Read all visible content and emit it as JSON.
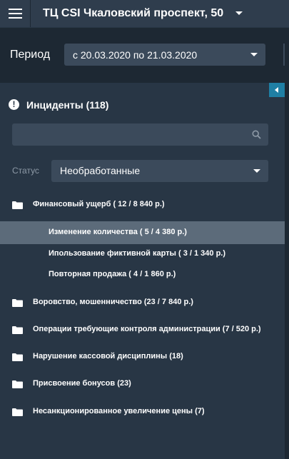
{
  "header": {
    "title": "ТЦ CSI Чкаловский проспект, 50"
  },
  "period": {
    "label": "Период",
    "value": "с 20.03.2020 по 21.03.2020"
  },
  "incidents": {
    "title": "Инциденты (118)",
    "search_placeholder": "",
    "status_label": "Статус",
    "status_value": "Необработанные"
  },
  "tree": {
    "groups": [
      {
        "label": "Финансовый ущерб ( 12 / 8 840 р.)"
      },
      {
        "label": "Воровство, мошенничество (23 / 7 840 р.)"
      },
      {
        "label": "Операции требующие контроля администрации (7 / 520 р.)"
      },
      {
        "label": "Нарушение кассовой дисциплины (18)"
      },
      {
        "label": "Присвоение бонусов (23)"
      },
      {
        "label": "Несанкционированное увеличение цены (7)"
      }
    ],
    "children": [
      {
        "label": "Изменение количества ( 5 / 4 380 р.)",
        "selected": true
      },
      {
        "label": "Ипользование фиктивной карты ( 3 / 1 340 р.)"
      },
      {
        "label": "Повторная продажа ( 4 / 1 860 р.)"
      }
    ]
  },
  "colors": {
    "background": "#283645",
    "header": "#2f3d4d",
    "period_bar": "#1d2833",
    "input": "#3b4a5b",
    "selected_row": "#5c6b7a",
    "accent": "#1f7fa4"
  },
  "icons": [
    "menu-icon",
    "chevron-down-icon",
    "alert-icon",
    "search-icon",
    "folder-icon",
    "collapse-left-icon"
  ]
}
